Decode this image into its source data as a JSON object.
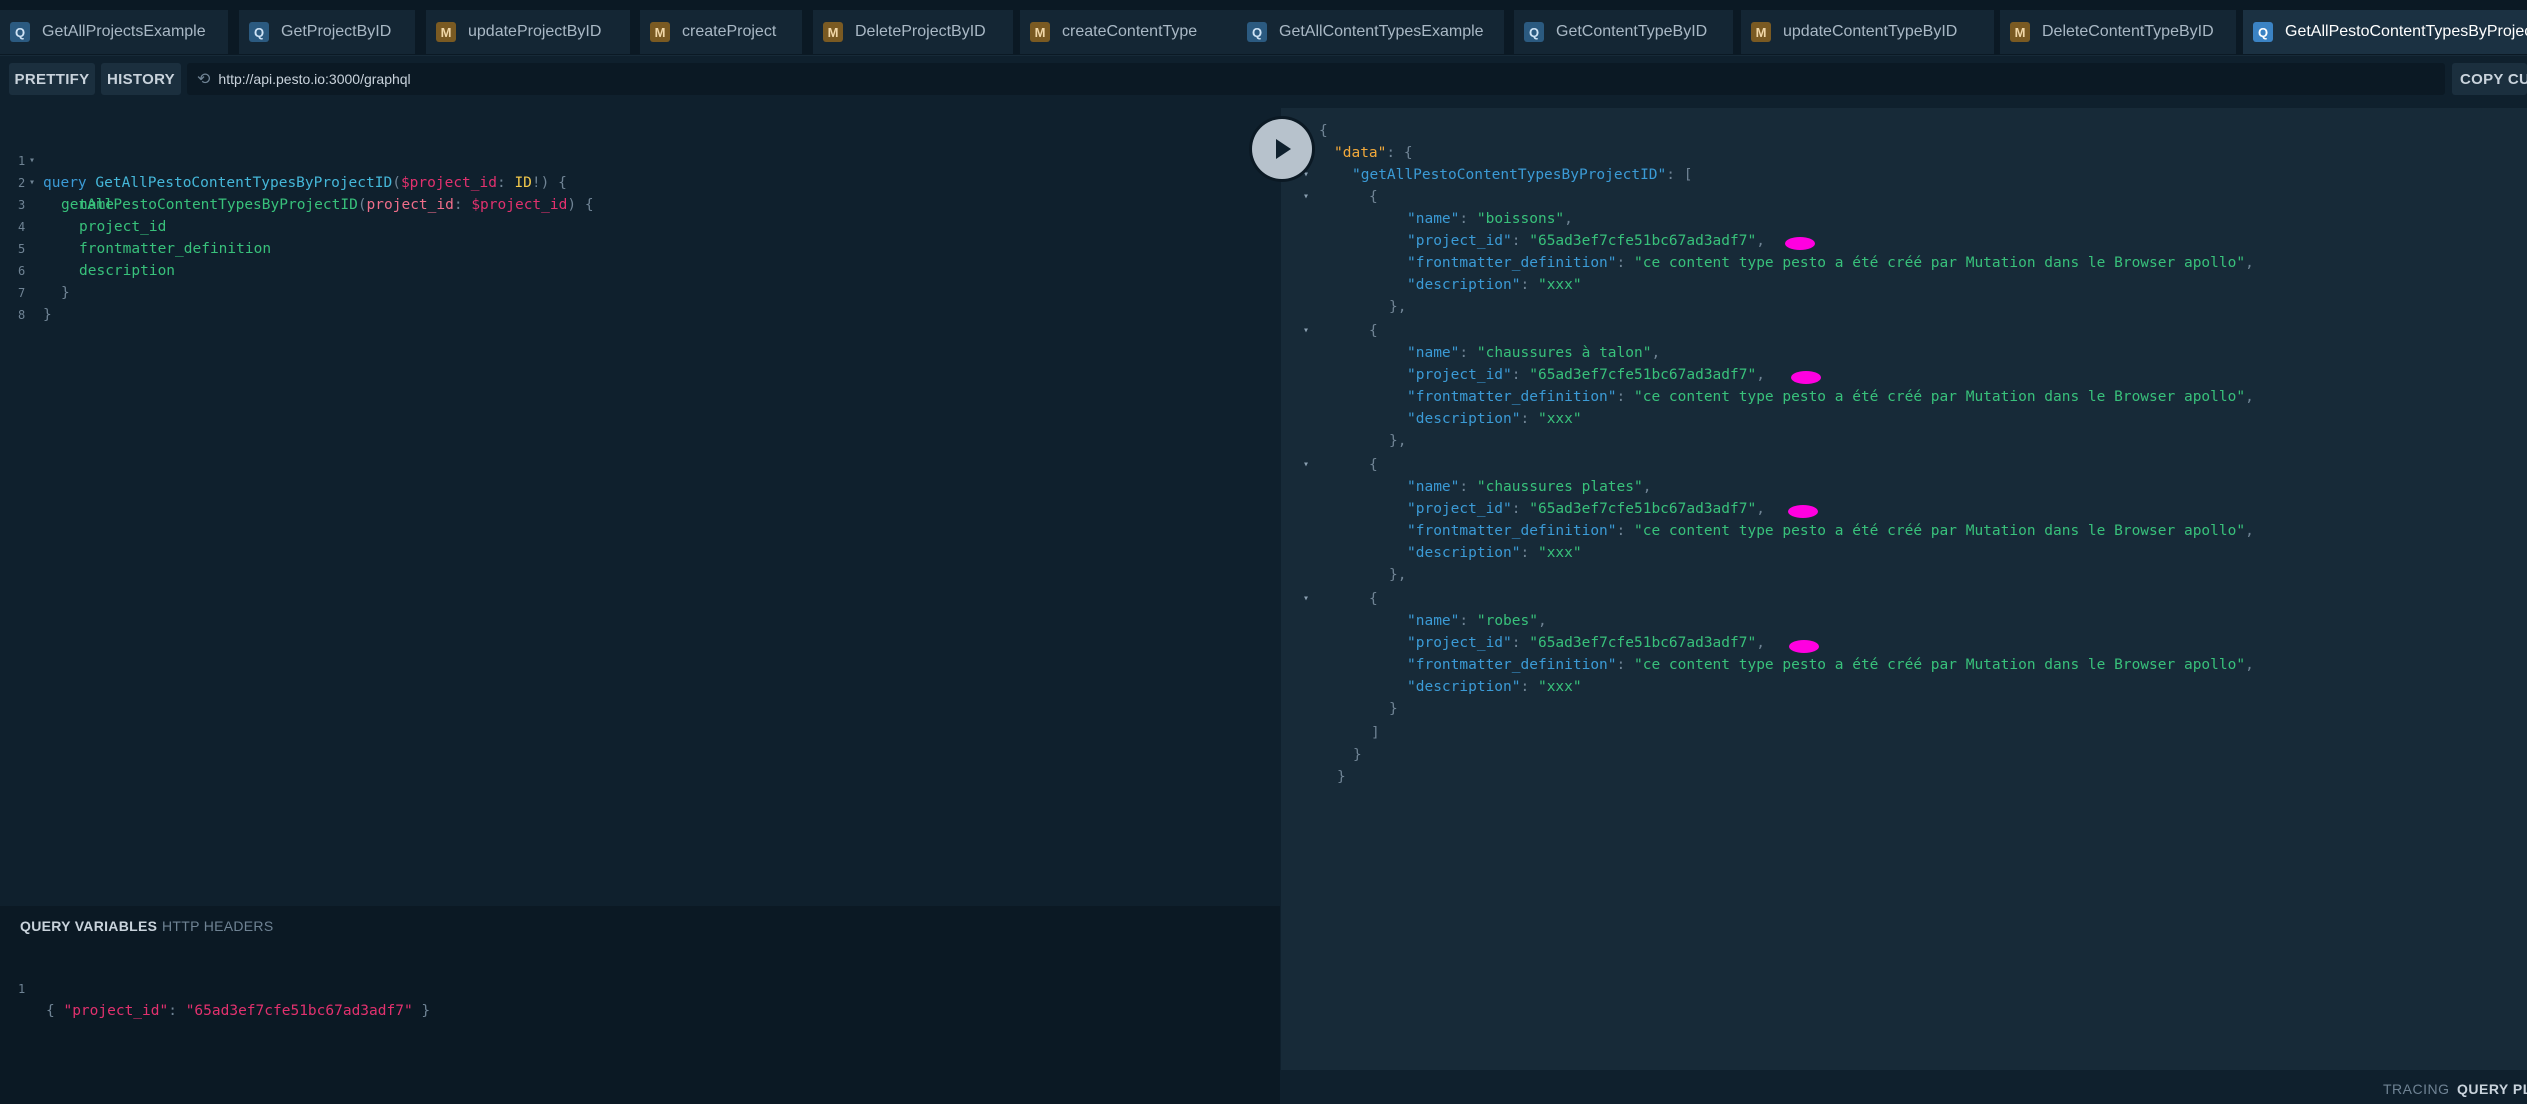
{
  "tabs": [
    {
      "badge": "Q",
      "label": "GetAllProjectsExample"
    },
    {
      "badge": "Q",
      "label": "GetProjectByID"
    },
    {
      "badge": "M",
      "label": "updateProjectByID"
    },
    {
      "badge": "M",
      "label": "createProject"
    },
    {
      "badge": "M",
      "label": "DeleteProjectByID"
    },
    {
      "badge": "M",
      "label": "createContentType"
    },
    {
      "badge": "Q",
      "label": "GetAllContentTypesExample"
    },
    {
      "badge": "Q",
      "label": "GetContentTypeByID"
    },
    {
      "badge": "M",
      "label": "updateContentTypeByID"
    },
    {
      "badge": "M",
      "label": "DeleteContentTypeByID"
    },
    {
      "badge": "Q",
      "label": "GetAllPestoContentTypesByProjectID"
    }
  ],
  "toolbar": {
    "prettify": "PRETTIFY",
    "history": "HISTORY",
    "endpoint": "http://api.pesto.io:3000/graphql",
    "copy_curl": "COPY CURL"
  },
  "query": {
    "line_numbers": [
      "1",
      "2",
      "3",
      "4",
      "5",
      "6",
      "7",
      "8"
    ],
    "l1": {
      "kw": "query",
      "name": "GetAllPestoContentTypesByProjectID",
      "open": "(",
      "var": "$project_id",
      "colon": ":",
      "type": "ID",
      "bang": "!",
      "close": ") {"
    },
    "l2": {
      "field": "getAllPestoContentTypesByProjectID",
      "open": "(",
      "arg": "project_id",
      "colon": ":",
      "var": "$project_id",
      "close": ") {"
    },
    "fields": [
      "name",
      "project_id",
      "frontmatter_definition",
      "description"
    ],
    "l7": "}",
    "l8": "}"
  },
  "variables_panel": {
    "tab_variables": "QUERY VARIABLES",
    "tab_headers": "HTTP HEADERS",
    "line_number": "1",
    "open": "{",
    "key": "\"project_id\"",
    "colon": ":",
    "value": "\"65ad3ef7cfe51bc67ad3adf7\"",
    "close": "}"
  },
  "result": {
    "root_key": "\"data\"",
    "field_key": "\"getAllPestoContentTypesByProjectID\"",
    "keys": {
      "name": "\"name\"",
      "project_id": "\"project_id\"",
      "frontmatter_definition": "\"frontmatter_definition\"",
      "description": "\"description\""
    },
    "items": [
      {
        "name": "\"boissons\"",
        "project_id": "\"65ad3ef7cfe51bc67ad3adf7\"",
        "frontmatter_definition": "\"ce content type pesto a été créé par Mutation dans le Browser apollo\"",
        "description": "\"xxx\""
      },
      {
        "name": "\"chaussures à talon\"",
        "project_id": "\"65ad3ef7cfe51bc67ad3adf7\"",
        "frontmatter_definition": "\"ce content type pesto a été créé par Mutation dans le Browser apollo\"",
        "description": "\"xxx\""
      },
      {
        "name": "\"chaussures plates\"",
        "project_id": "\"65ad3ef7cfe51bc67ad3adf7\"",
        "frontmatter_definition": "\"ce content type pesto a été créé par Mutation dans le Browser apollo\"",
        "description": "\"xxx\""
      },
      {
        "name": "\"robes\"",
        "project_id": "\"65ad3ef7cfe51bc67ad3adf7\"",
        "frontmatter_definition": "\"ce content type pesto a été créé par Mutation dans le Browser apollo\"",
        "description": "\"xxx\""
      }
    ]
  },
  "footer": {
    "tracing": "TRACING",
    "query_plan": "QUERY PLAN"
  },
  "icons": {
    "run": "play-icon",
    "history": "refresh-icon"
  }
}
